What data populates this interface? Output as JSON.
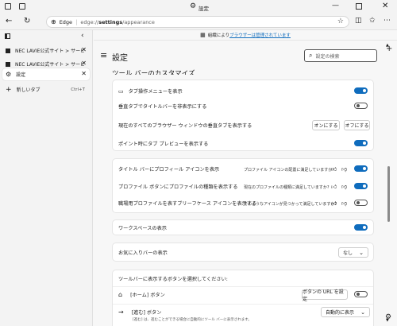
{
  "window": {
    "tab_title": "設定"
  },
  "address": {
    "site": "Edge",
    "url_prefix": "edge://",
    "url_bold": "settings",
    "url_rest": "/appearance"
  },
  "sidebar": {
    "tabs": [
      {
        "label": "NEC LAVIE公式サイト > サービス&サ"
      },
      {
        "label": "NEC LAVIE公式サイト > サービス&サ"
      },
      {
        "label": "設定"
      }
    ],
    "new_tab": "新しいタブ",
    "new_tab_shortcut": "Ctrl+T"
  },
  "infobar": {
    "text": "組織により",
    "link": "ブラウザーは管理されています"
  },
  "header": {
    "title": "設定",
    "search_placeholder": "設定の検索"
  },
  "section_title": "ツール バーのカスタマイズ",
  "card1": {
    "rows": [
      {
        "label": "タブ操作メニューを表示",
        "toggle": "on"
      },
      {
        "label": "垂直タブでタイトルバーを非表示にする",
        "toggle": "off"
      },
      {
        "label": "現在のすべてのブラウザー ウィンドウの垂直タブを表示する",
        "btn1": "オンにする",
        "btn2": "オフにする"
      },
      {
        "label": "ポイント時にタブ プレビューを表示する",
        "toggle": "on"
      }
    ]
  },
  "card2": {
    "rows": [
      {
        "label": "タイトル バーにプロフィール アイコンを表示",
        "feedback": "プロファイル アイコンの配置に満足していますか?",
        "toggle": "on"
      },
      {
        "label": "プロファイル ボタンにプロファイルの種類を表示する",
        "feedback": "現在のプロファイルの種類に満足していますか?",
        "toggle": "on"
      },
      {
        "label": "職場用プロファイルを表すブリーフケース アイコンを表示する",
        "feedback": "そのようなアイコンが見つかって満足していますか?",
        "toggle": "off"
      }
    ]
  },
  "card3": {
    "label": "ワークスペースの表示",
    "toggle": "on"
  },
  "card4": {
    "label": "お気に入りバーの表示",
    "select": "なし"
  },
  "card5": {
    "heading": "ツールバーに表示するボタンを選択してください:",
    "home": {
      "label": "[ホーム] ボタン",
      "btn": "ボタンの URL を設定",
      "toggle": "off"
    },
    "forward": {
      "label": "[進む] ボタン",
      "sub": "[進む] は、進むことができる場合に自動的にツール バーに表示されます。",
      "select": "自動的に表示"
    }
  },
  "colors": {
    "accent": "#0f6cbd"
  }
}
